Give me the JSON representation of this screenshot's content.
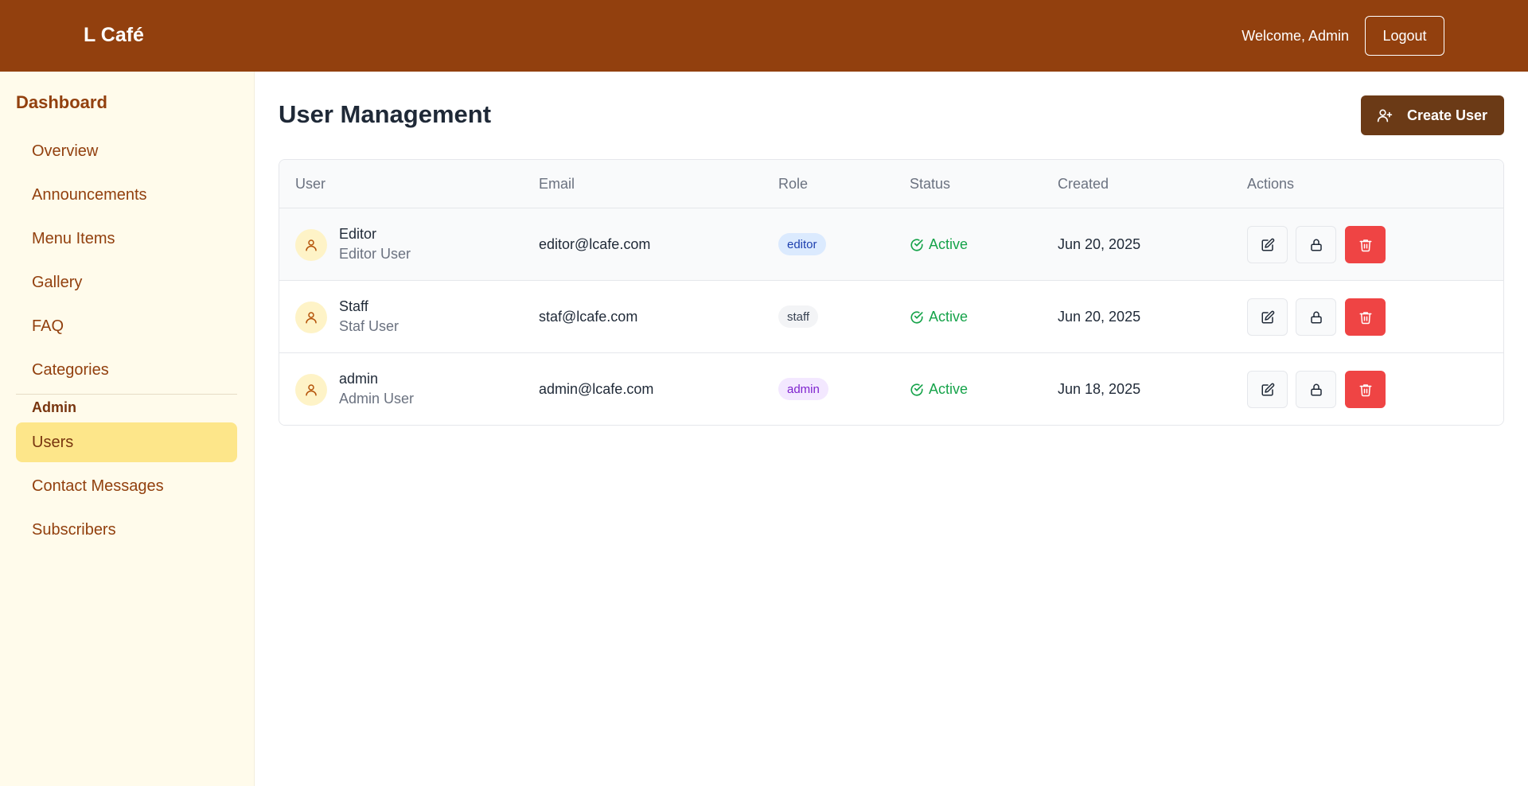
{
  "header": {
    "brand": "L Café",
    "welcome": "Welcome, Admin",
    "logout_label": "Logout",
    "bg_color": "#92400e"
  },
  "sidebar": {
    "title": "Dashboard",
    "items": [
      {
        "label": "Overview"
      },
      {
        "label": "Announcements"
      },
      {
        "label": "Menu Items"
      },
      {
        "label": "Gallery"
      },
      {
        "label": "FAQ"
      },
      {
        "label": "Categories"
      }
    ],
    "admin_section": "Admin",
    "admin_items": [
      {
        "label": "Users",
        "active": true
      },
      {
        "label": "Contact Messages"
      },
      {
        "label": "Subscribers"
      }
    ]
  },
  "main": {
    "title": "User Management",
    "create_button_label": "Create User",
    "table": {
      "headers": [
        "User",
        "Email",
        "Role",
        "Status",
        "Created",
        "Actions"
      ],
      "rows": [
        {
          "username": "Editor",
          "full_name": "Editor User",
          "email": "editor@lcafe.com",
          "role": "editor",
          "status": "Active",
          "created": "Jun 20, 2025"
        },
        {
          "username": "Staff",
          "full_name": "Staf User",
          "email": "staf@lcafe.com",
          "role": "staff",
          "status": "Active",
          "created": "Jun 20, 2025"
        },
        {
          "username": "admin",
          "full_name": "Admin User",
          "email": "admin@lcafe.com",
          "role": "admin",
          "status": "Active",
          "created": "Jun 18, 2025"
        }
      ]
    }
  },
  "icons": {
    "user_avatar": "user-icon",
    "create_user": "user-plus-icon",
    "status": "check-circle-icon",
    "edit": "edit-icon",
    "lock": "lock-icon",
    "delete": "trash-icon"
  },
  "colors": {
    "accent": "#92400e",
    "sidebar_bg": "#fffbeb",
    "active_item": "#fde68a",
    "create_button": "#6b3a16",
    "delete": "#ef4444",
    "status_active": "#16a34a"
  }
}
